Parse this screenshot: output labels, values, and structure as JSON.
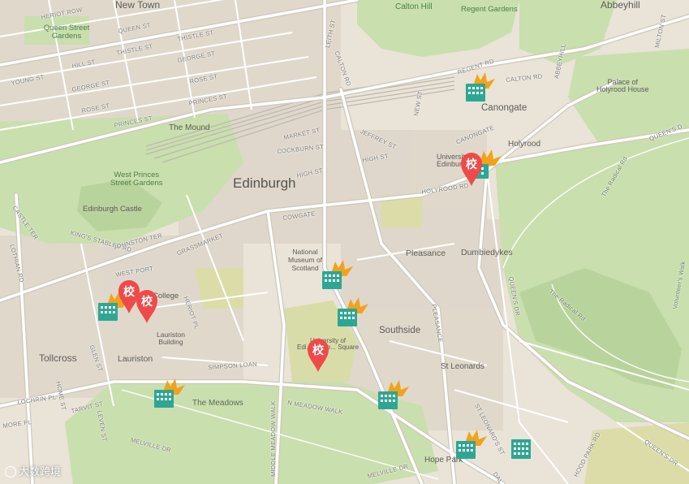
{
  "map": {
    "areas": {
      "new_town": "New Town",
      "queen_street_gardens": "Queen Street\nGardens",
      "calton_hill": "Calton Hill",
      "regent_gardens": "Regent Gardens",
      "abbeyhill": "Abbeyhill",
      "palace": "Palace of\nHolyrood House",
      "canongate": "Canongate",
      "holyrood": "Holyrood",
      "the_mound": "The Mound",
      "west_princes": "West Princes\nStreet Gardens",
      "edinburgh": "Edinburgh",
      "edinburgh_castle": "Edinburgh Castle",
      "national_museum": "National\nMuseum of\nScotland",
      "pleasance": "Pleasance",
      "dumbiedykes": "Dumbiedykes",
      "university": "University\nEdinburgh",
      "southside": "Southside",
      "lauriston": "Lauriston\nBuilding",
      "lauriston_area": "Lauriston",
      "tollcross": "Tollcross",
      "uni_square": "University of\nEdi... — Ge... Square",
      "college": "College",
      "st_leonards": "St Leonards",
      "the_meadows": "The Meadows",
      "hope_park": "Hope Park",
      "radical_rd": "The Radical Rd",
      "volunteers_walk": "Volunteer's Walk"
    },
    "streets": {
      "heriot_row": "HERIOT ROW",
      "queen_st": "QUEEN ST",
      "thistle_st1": "THISTLE ST",
      "thistle_st2": "THISTLE ST",
      "hill_st": "HILL ST",
      "young_st": "YOUNG ST",
      "george_st1": "GEORGE ST",
      "george_st2": "GEORGE ST",
      "rose_st1": "ROSE ST",
      "rose_st2": "ROSE ST",
      "princes_st1": "PRINCES ST",
      "princes_st2": "PRINCES ST",
      "leith_st": "LEITH ST",
      "calton_rd1": "CALTON RD",
      "calton_rd2": "CALTON RD",
      "regent_rd": "REGENT RD",
      "abbeyhill_st": "ABBEYHILL",
      "milton_st": "MILTON ST",
      "market_st": "MARKET ST",
      "cockburn_st": "COCKBURN ST",
      "high_st1": "HIGH ST",
      "high_st2": "HIGH ST",
      "jeffrey_st": "JEFFREY ST",
      "new_st": "NEW ST",
      "canongate_st": "CANONGATE",
      "queens_dr1": "QUEEN'S D",
      "queens_dr2": "QUEEN'S DR",
      "queens_dr3": "QUEEN'S DR",
      "holyrood_rd": "HOLYROOD RD",
      "cowgate": "COWGATE",
      "castle_ter": "CASTLE TER",
      "kings_stables": "KING'S STABLES RD",
      "johnston_ter": "JOHNSTON TER",
      "grassmarket": "GRASSMARKET",
      "lothian_rd": "LOTHIAN RD",
      "west_port": "WEST PORT",
      "heriot_pl": "HERIOT PL",
      "pleasance_st": "PLEASANCE",
      "glen_st": "GLEN ST",
      "simpson_loan": "SIMPSON LOAN",
      "home_st": "HOME ST",
      "lochrin_pl": "LOCHRIN PL",
      "tarvit_st": "TARVIT ST",
      "more_pl": "MORE PL",
      "leven_st": "LEVEN ST",
      "n_meadow_walk": "N MEADOW WALK",
      "middle_meadow_walk": "MIDDLE MEADOW WALK",
      "melville_dr1": "MELVILLE DR",
      "melville_dr2": "MELVILLE DR",
      "st_leonards_st": "ST LEONARD'S ST",
      "dalkeith": "DAL",
      "hood_park_rd": "HOOD PARK RD"
    },
    "pins": [
      {
        "label": "校"
      },
      {
        "label": "校"
      },
      {
        "label": "校"
      },
      {
        "label": "校"
      }
    ],
    "watermark": "大数跨境",
    "colors": {
      "land": "#e9e3d8",
      "park": "#c9dfae",
      "park_dark": "#b9d39d",
      "block": "#d9d0c3",
      "road": "#ffffff",
      "road_outline": "#cfc7ba",
      "rail": "#bdb7ad",
      "pin": "#ef4a4a",
      "building_icon": "#2ea694",
      "flame_icon": "#f2a21b"
    }
  }
}
